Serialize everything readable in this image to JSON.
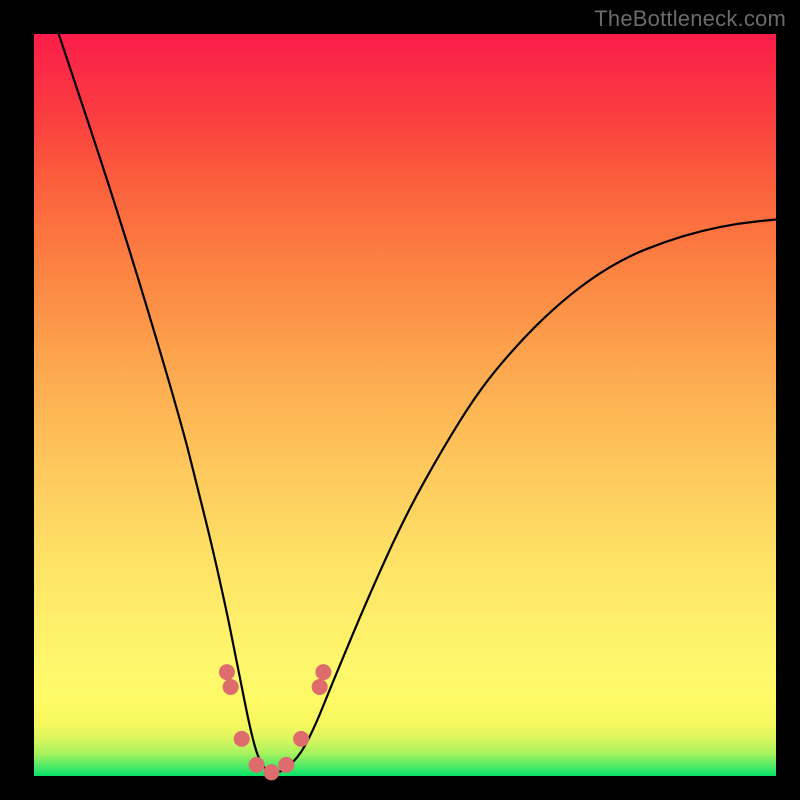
{
  "watermark": "TheBottleneck.com",
  "colors": {
    "black": "#000000",
    "marker": "#de6c6d",
    "gradient_top": "#fb1d4b",
    "gradient_mid": "#fef06a",
    "gradient_bottom": "#06e169"
  },
  "chart_data": {
    "type": "line",
    "title": "",
    "xlabel": "",
    "ylabel": "",
    "xlim": [
      0,
      100
    ],
    "ylim": [
      0,
      100
    ],
    "grid": false,
    "series": [
      {
        "name": "bottleneck-curve",
        "x": [
          0,
          5,
          10,
          15,
          20,
          22,
          24,
          26,
          27,
          28,
          29,
          30,
          31,
          32,
          33,
          34,
          36,
          38,
          40,
          45,
          50,
          55,
          60,
          65,
          70,
          75,
          80,
          85,
          90,
          95,
          100
        ],
        "values": [
          110,
          95,
          80,
          64,
          47,
          39,
          31,
          22,
          17,
          12,
          7,
          3,
          1,
          0.5,
          0.5,
          1,
          3,
          7,
          12,
          24,
          35,
          44,
          52,
          58,
          63,
          67,
          70,
          72,
          73.5,
          74.5,
          75
        ]
      }
    ],
    "markers": [
      {
        "x": 26.0,
        "y": 14.0
      },
      {
        "x": 26.5,
        "y": 12.0
      },
      {
        "x": 28.0,
        "y": 5.0
      },
      {
        "x": 30.0,
        "y": 1.5
      },
      {
        "x": 32.0,
        "y": 0.5
      },
      {
        "x": 34.0,
        "y": 1.5
      },
      {
        "x": 36.0,
        "y": 5.0
      },
      {
        "x": 38.5,
        "y": 12.0
      },
      {
        "x": 39.0,
        "y": 14.0
      }
    ],
    "marker_radius_px": 8
  }
}
